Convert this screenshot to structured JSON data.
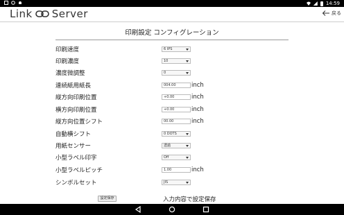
{
  "status_bar": {
    "time": "14:59"
  },
  "app": {
    "logo_left": "Link",
    "logo_right": "Server",
    "back_label": "戻る"
  },
  "page": {
    "title": "印刷設定 コンフィグレーション"
  },
  "settings": [
    {
      "label": "印刷速度",
      "type": "select",
      "value": "6 IPS"
    },
    {
      "label": "印刷濃度",
      "type": "select",
      "value": "10"
    },
    {
      "label": "濃度微調整",
      "type": "select",
      "value": "0"
    },
    {
      "label": "連続紙用紙長",
      "type": "input",
      "value": "004.00",
      "unit": "inch"
    },
    {
      "label": "縦方向印刷位置",
      "type": "input",
      "value": "+0.00",
      "unit": "inch"
    },
    {
      "label": "横方向印刷位置",
      "type": "input",
      "value": "+0.00",
      "unit": "inch"
    },
    {
      "label": "縦方向位置シフト",
      "type": "input",
      "value": "00.00",
      "unit": "inch"
    },
    {
      "label": "自動横シフト",
      "type": "select",
      "value": "0 DOTS"
    },
    {
      "label": "用紙センサー",
      "type": "select",
      "value": "透過"
    },
    {
      "label": "小型ラベル印字",
      "type": "select",
      "value": "Off"
    },
    {
      "label": "小型ラベルピッチ",
      "type": "input",
      "value": "1.00",
      "unit": "inch"
    },
    {
      "label": "シンボルセット",
      "type": "select",
      "value": "JIS"
    }
  ],
  "footer": {
    "save_button": "設定保存",
    "save_note": "入力内容で設定保存"
  }
}
